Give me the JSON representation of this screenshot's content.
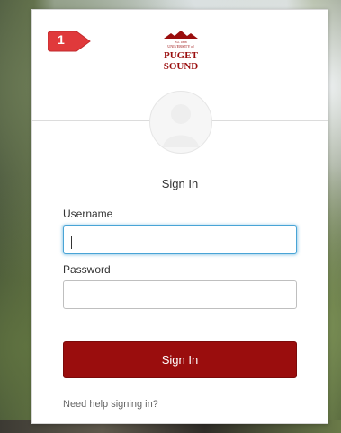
{
  "logo": {
    "tagline": "Est. 1888",
    "line1": "UNIVERSITY of",
    "line2": "PUGET",
    "line3": "SOUND",
    "brand_color": "#9a0d0d"
  },
  "step_badge": {
    "number": "1",
    "color": "#e0393b"
  },
  "form": {
    "title": "Sign In",
    "username_label": "Username",
    "username_value": "",
    "password_label": "Password",
    "password_value": "",
    "submit_label": "Sign In",
    "help_link": "Need help signing in?"
  },
  "colors": {
    "accent": "#9a0d0d",
    "focus": "#49a4d6"
  },
  "icons": {
    "avatar": "user-silhouette-icon",
    "logo_mark": "mountain-icon"
  }
}
